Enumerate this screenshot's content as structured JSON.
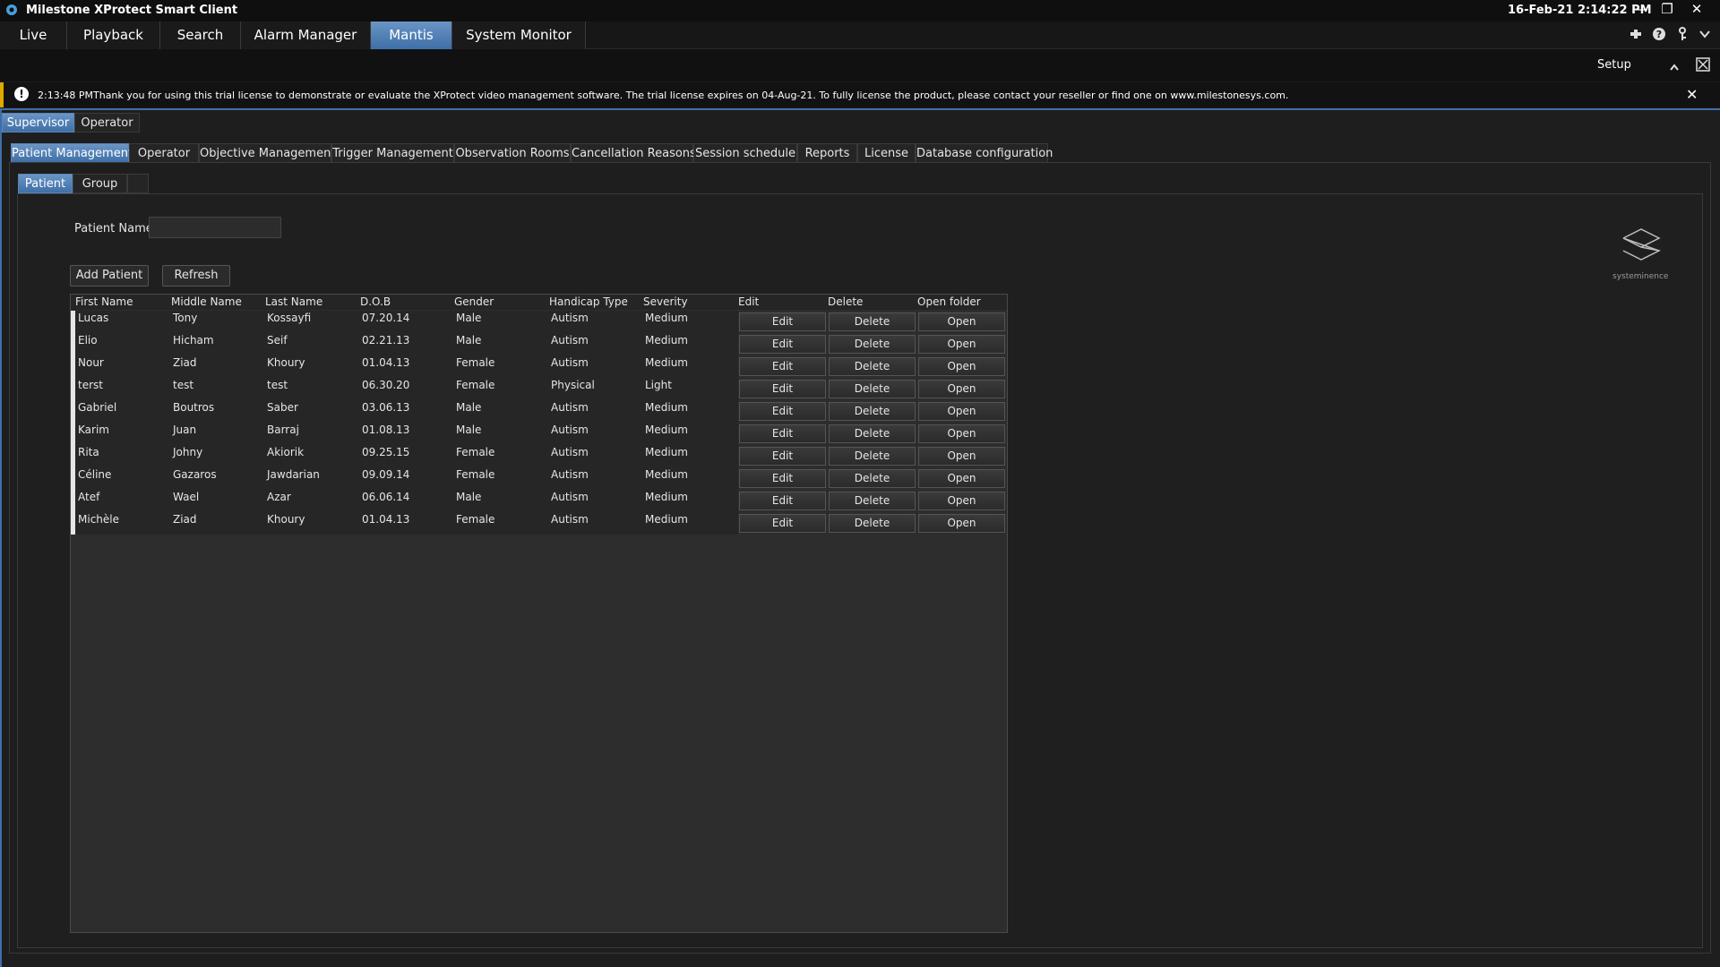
{
  "window": {
    "title": "Milestone XProtect Smart Client",
    "datetime": "16-Feb-21 2:14:22 PM",
    "controls": {
      "minimize": "—",
      "restore": "❐",
      "close": "✕"
    }
  },
  "main_nav": {
    "tabs": [
      "Live",
      "Playback",
      "Search",
      "Alarm Manager",
      "Mantis",
      "System Monitor"
    ],
    "active": "Mantis"
  },
  "setup": {
    "label": "Setup"
  },
  "banner": {
    "icon": "!",
    "time": "2:13:48 PM",
    "message": "Thank you for using this trial license to demonstrate or evaluate the XProtect video management software. The trial license expires on 04-Aug-21. To fully license the product, please contact your reseller or find one on www.milestonesys.com.",
    "close": "✕"
  },
  "role_tabs": [
    "Supervisor",
    "Operator"
  ],
  "section_tabs": [
    "Patient Management",
    "Operator",
    "Objective Management",
    "Trigger Management",
    "Observation Rooms",
    "Cancellation Reasons",
    "Session schedule",
    "Reports",
    "License",
    "Database configuration"
  ],
  "sub_tabs": [
    "Patient",
    "Group"
  ],
  "form": {
    "patient_name_label": "Patient Name",
    "patient_name_value": "",
    "add_label": "Add Patient",
    "refresh_label": "Refresh"
  },
  "table": {
    "columns": [
      "First Name",
      "Middle Name",
      "Last Name",
      "D.O.B",
      "Gender",
      "Handicap Type",
      "Severity",
      "Edit",
      "Delete",
      "Open folder"
    ],
    "edit_label": "Edit",
    "delete_label": "Delete",
    "open_label": "Open",
    "rows": [
      [
        "Lucas",
        "Tony",
        "Kossayfi",
        "07.20.14",
        "Male",
        "Autism",
        "Medium"
      ],
      [
        "Elio",
        "Hicham",
        "Seif",
        "02.21.13",
        "Male",
        "Autism",
        "Medium"
      ],
      [
        "Nour",
        "Ziad",
        "Khoury",
        "01.04.13",
        "Female",
        "Autism",
        "Medium"
      ],
      [
        "terst",
        "test",
        "test",
        "06.30.20",
        "Female",
        "Physical",
        "Light"
      ],
      [
        "Gabriel",
        "Boutros",
        "Saber",
        "03.06.13",
        "Male",
        "Autism",
        "Medium"
      ],
      [
        "Karim",
        "Juan",
        "Barraj",
        "01.08.13",
        "Male",
        "Autism",
        "Medium"
      ],
      [
        "Rita",
        "Johny",
        "Akiorik",
        "09.25.15",
        "Female",
        "Autism",
        "Medium"
      ],
      [
        "Céline",
        "Gazaros",
        "Jawdarian",
        "09.09.14",
        "Female",
        "Autism",
        "Medium"
      ],
      [
        "Atef",
        "Wael",
        "Azar",
        "06.06.14",
        "Male",
        "Autism",
        "Medium"
      ],
      [
        "Michèle",
        "Ziad",
        "Khoury",
        "01.04.13",
        "Female",
        "Autism",
        "Medium"
      ]
    ]
  },
  "brand": {
    "name": "systeminence"
  },
  "colors": {
    "accent": "#3e6fa7",
    "warning": "#e0a700",
    "background": "#1e1e1e"
  }
}
